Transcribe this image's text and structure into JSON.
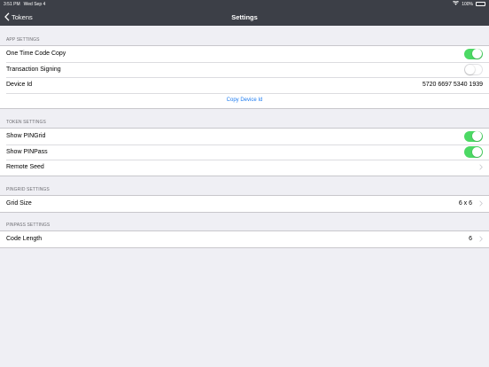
{
  "status": {
    "time": "3:51 PM",
    "date": "Wed Sep 4",
    "battery": "100%"
  },
  "nav": {
    "back_label": "Tokens",
    "title": "Settings"
  },
  "app_settings": {
    "header": "APP SETTINGS",
    "one_time_code_copy": {
      "label": "One Time Code Copy",
      "on": true
    },
    "transaction_signing": {
      "label": "Transaction Signing",
      "on": false
    },
    "device_id": {
      "label": "Device Id",
      "value": "5720 6697 5340 1939"
    },
    "copy_device_id": "Copy Device Id"
  },
  "token_settings": {
    "header": "TOKEN SETTINGS",
    "show_pingrid": {
      "label": "Show PINGrid",
      "on": true
    },
    "show_pinpass": {
      "label": "Show PINPass",
      "on": true
    },
    "remote_seed": {
      "label": "Remote Seed"
    }
  },
  "pingrid_settings": {
    "header": "PINGRID SETTINGS",
    "grid_size": {
      "label": "Grid Size",
      "value": "6 x 6"
    }
  },
  "pinpass_settings": {
    "header": "PINPASS SETTINGS",
    "code_length": {
      "label": "Code Length",
      "value": "6"
    }
  },
  "colors": {
    "bar": "#3c3f47",
    "toggle_on": "#4cd964",
    "link": "#1e7cf0",
    "background": "#efeff4"
  },
  "icons": {
    "back": "chevron-left-icon",
    "disclosure": "chevron-right-icon",
    "wifi": "wifi-icon",
    "battery": "battery-icon"
  }
}
